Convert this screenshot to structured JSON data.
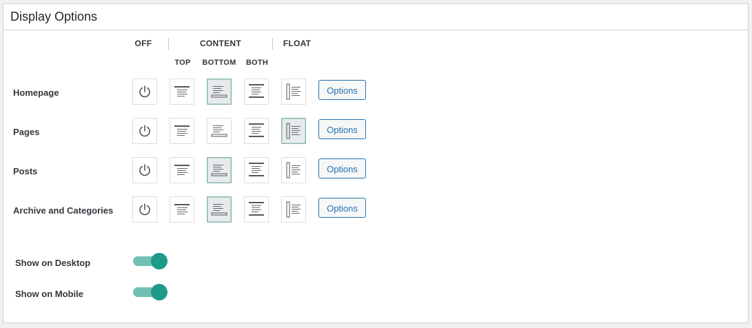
{
  "panel": {
    "title": "Display Options"
  },
  "columns": {
    "off": "OFF",
    "content": "CONTENT",
    "float": "FLOAT",
    "top": "TOP",
    "bottom": "BOTTOM",
    "both": "BOTH"
  },
  "rows": [
    {
      "label": "Homepage",
      "selected": "bottom",
      "options_label": "Options"
    },
    {
      "label": "Pages",
      "selected": "float",
      "options_label": "Options"
    },
    {
      "label": "Posts",
      "selected": "bottom",
      "options_label": "Options"
    },
    {
      "label": "Archive and Categories",
      "selected": "bottom",
      "options_label": "Options"
    }
  ],
  "toggles": [
    {
      "label": "Show on Desktop",
      "on": true
    },
    {
      "label": "Show on Mobile",
      "on": true
    }
  ],
  "colors": {
    "accent": "#1c9a8a",
    "link": "#2271b1"
  },
  "icons": {
    "off": "power-icon",
    "top": "content-top-icon",
    "bottom": "content-bottom-icon",
    "both": "content-both-icon",
    "float": "float-icon"
  }
}
